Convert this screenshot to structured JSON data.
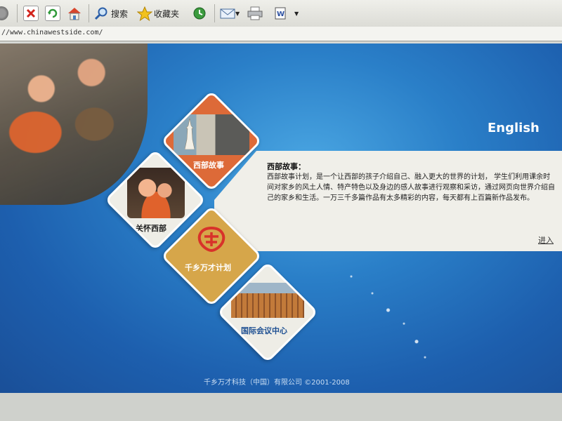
{
  "toolbar": {
    "search_label": "搜索",
    "favorites_label": "收藏夹"
  },
  "address": {
    "url": "//www.chinawestside.com/"
  },
  "page": {
    "english_link": "English",
    "info": {
      "title": "西部故事：",
      "body": "西部故事计划，是一个让西部的孩子介绍自己、融入更大的世界的计划， 学生们利用课余时间对家乡的风土人情、特产特色以及身边的感人故事进行观察和采访，通过网页向世界介绍自己的家乡和生活。一万三千多篇作品有太多精彩的内容，每天都有上百篇新作品发布。",
      "enter": "进入"
    },
    "tiles": {
      "west_story": "西部故事",
      "care_west": "关怀西部",
      "program": "千乡万才计划",
      "conference": "国际会议中心"
    },
    "footer": "千乡万才科技（中国）有限公司 ©2001-2008"
  },
  "colors": {
    "page_blue": "#2a7fc8",
    "tile_orange": "#dd6a38",
    "tile_gold": "#d6a64a",
    "logo_red": "#d8322a"
  }
}
